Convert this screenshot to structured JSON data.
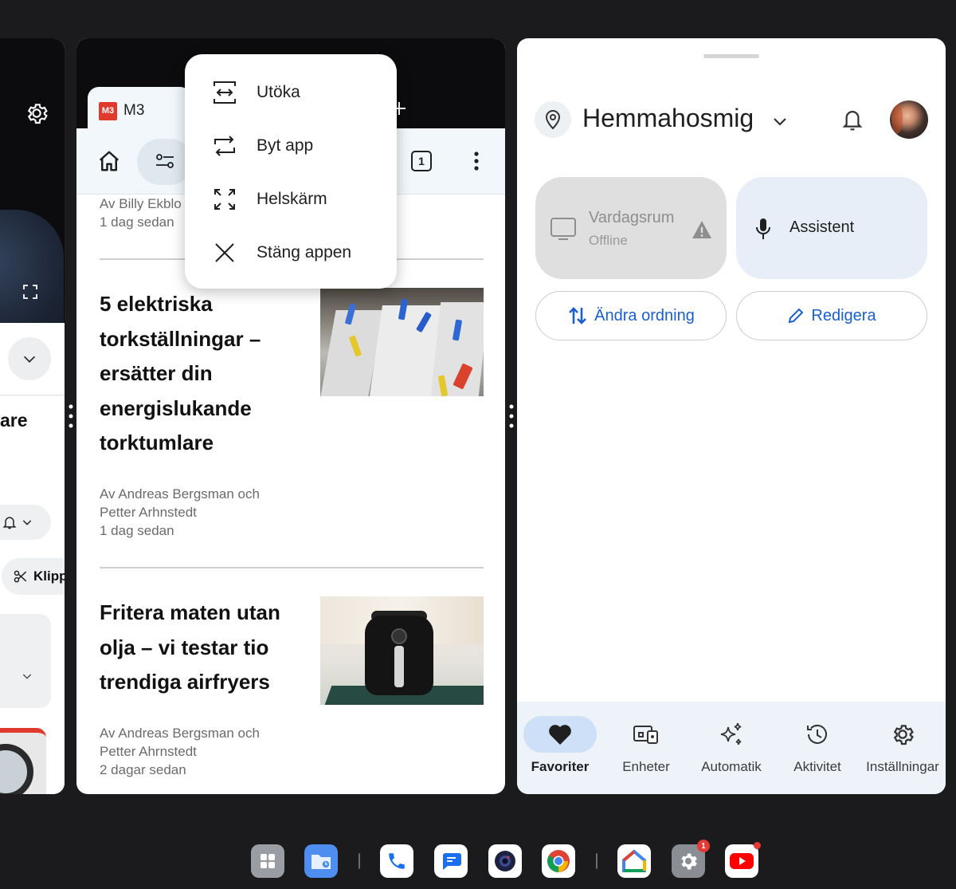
{
  "left_app": {
    "partial_heading": "are",
    "chip_label": "Klipp"
  },
  "browser": {
    "tab_logo": "M3",
    "tab_title": "M3",
    "tab_count": "1",
    "articles": [
      {
        "meta_lines": [
          "Av Billy Ekblo",
          "1 dag sedan"
        ]
      },
      {
        "title_lines": [
          "5 elektriska",
          "torkställningar –",
          "ersätter din",
          "energislukande",
          "torktumlare"
        ],
        "meta_lines": [
          "Av Andreas Bergsman och",
          "Petter Arhnstedt",
          "1 dag sedan"
        ]
      },
      {
        "title_lines": [
          "Fritera maten utan",
          "olja – vi testar tio",
          "trendiga airfryers"
        ],
        "meta_lines": [
          "Av Andreas Bergsman och",
          "Petter Ahrnstedt",
          "2 dagar sedan"
        ]
      }
    ]
  },
  "context_menu": {
    "items": [
      {
        "label": "Utöka",
        "icon": "expand-icon"
      },
      {
        "label": "Byt app",
        "icon": "swap-icon"
      },
      {
        "label": "Helskärm",
        "icon": "fullscreen-icon"
      },
      {
        "label": "Stäng appen",
        "icon": "close-icon"
      }
    ]
  },
  "home_app": {
    "home_name": "Hemmahosmig",
    "tiles": [
      {
        "name": "Vardagsrum",
        "status": "Offline",
        "icon": "tv-icon"
      },
      {
        "name": "Assistent",
        "icon": "mic-icon"
      }
    ],
    "buttons": [
      {
        "label": "Ändra ordning",
        "icon": "reorder-icon"
      },
      {
        "label": "Redigera",
        "icon": "pencil-icon"
      }
    ],
    "nav": [
      {
        "label": "Favoriter",
        "icon": "heart-icon",
        "active": true
      },
      {
        "label": "Enheter",
        "icon": "devices-icon"
      },
      {
        "label": "Automatik",
        "icon": "sparkle-icon"
      },
      {
        "label": "Aktivitet",
        "icon": "history-icon"
      },
      {
        "label": "Inställningar",
        "icon": "gear-icon"
      }
    ],
    "accent_color": "#1a5fcf"
  },
  "taskbar": {
    "apps": [
      {
        "name": "app-drawer",
        "icon": "grid-icon"
      },
      {
        "name": "files",
        "icon": "files-icon"
      },
      {
        "name": "phone",
        "icon": "phone-icon"
      },
      {
        "name": "messages",
        "icon": "messages-icon"
      },
      {
        "name": "camera",
        "icon": "camera-icon"
      },
      {
        "name": "chrome",
        "icon": "chrome-icon"
      },
      {
        "name": "google-home",
        "icon": "home-app-icon"
      },
      {
        "name": "settings",
        "icon": "settings-icon",
        "badge": "1"
      },
      {
        "name": "youtube",
        "icon": "youtube-icon",
        "notification_dot": true
      }
    ]
  }
}
